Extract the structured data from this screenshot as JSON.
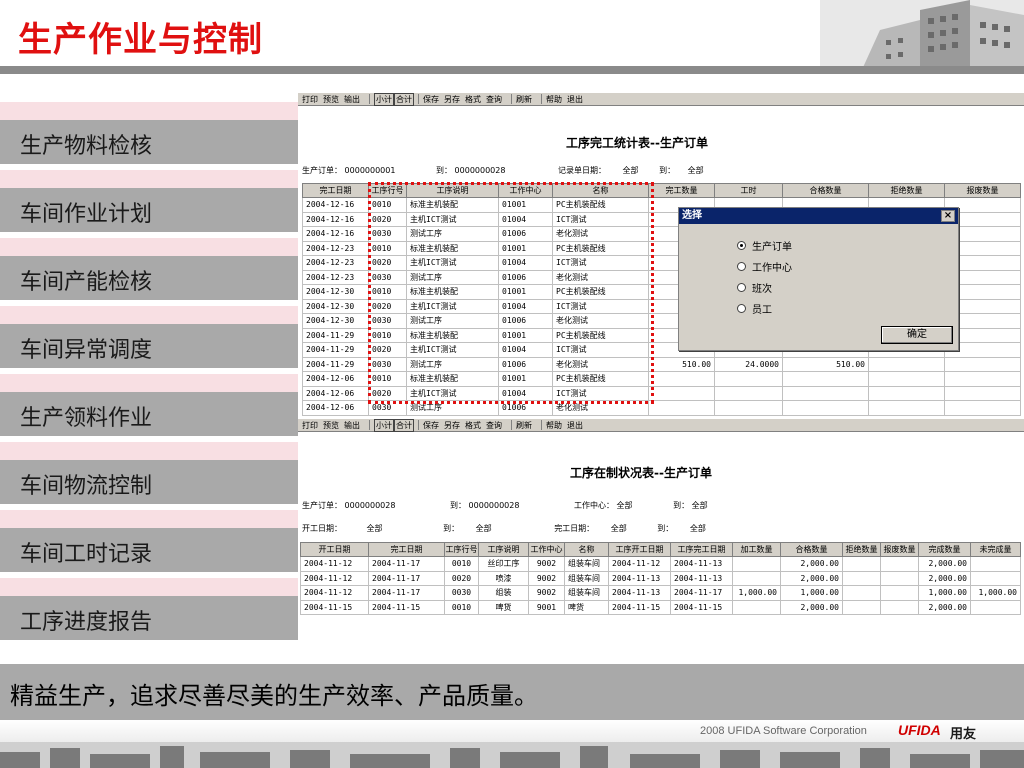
{
  "title": "生产作业与控制",
  "sidebar": {
    "items": [
      {
        "label": "生产物料检核"
      },
      {
        "label": "车间作业计划"
      },
      {
        "label": "车间产能检核"
      },
      {
        "label": "车间异常调度"
      },
      {
        "label": "生产领料作业"
      },
      {
        "label": "车间物流控制"
      },
      {
        "label": "车间工时记录"
      },
      {
        "label": "工序进度报告"
      }
    ]
  },
  "toolbar": {
    "buttons": [
      "打印",
      "预览",
      "输出",
      "小计",
      "合计",
      "保存",
      "另存",
      "格式",
      "查询",
      "刷新",
      "帮助",
      "退出"
    ]
  },
  "report1": {
    "title": "工序完工统计表--生产订单",
    "filter": {
      "order_label": "生产订单：",
      "order_from": "0000000001",
      "to_label": "到：",
      "order_to": "0000000028",
      "date_label": "记录单日期：",
      "date_from": "全部",
      "to_label2": "到：",
      "date_to": "全部"
    },
    "columns": [
      "完工日期",
      "工序行号",
      "工序说明",
      "工作中心",
      "名称",
      "完工数量",
      "工时",
      "合格数量",
      "拒绝数量",
      "报废数量"
    ],
    "rows": [
      [
        "2004-12-16",
        "0010",
        "标准主机装配",
        "01001",
        "PC主机装配线",
        "",
        "",
        "",
        "",
        ""
      ],
      [
        "2004-12-16",
        "0020",
        "主机ICT测试",
        "01004",
        "ICT测试",
        "",
        "",
        "",
        "",
        ""
      ],
      [
        "2004-12-16",
        "0030",
        "测试工序",
        "01006",
        "老化测试",
        "",
        "",
        "",
        "",
        ""
      ],
      [
        "2004-12-23",
        "0010",
        "标准主机装配",
        "01001",
        "PC主机装配线",
        "",
        "",
        "",
        "",
        ""
      ],
      [
        "2004-12-23",
        "0020",
        "主机ICT测试",
        "01004",
        "ICT测试",
        "",
        "",
        "",
        "",
        ""
      ],
      [
        "2004-12-23",
        "0030",
        "测试工序",
        "01006",
        "老化测试",
        "",
        "",
        "",
        "",
        ""
      ],
      [
        "2004-12-30",
        "0010",
        "标准主机装配",
        "01001",
        "PC主机装配线",
        "",
        "",
        "",
        "",
        ""
      ],
      [
        "2004-12-30",
        "0020",
        "主机ICT测试",
        "01004",
        "ICT测试",
        "",
        "",
        "",
        "",
        ""
      ],
      [
        "2004-12-30",
        "0030",
        "测试工序",
        "01006",
        "老化测试",
        "",
        "",
        "",
        "",
        ""
      ],
      [
        "2004-11-29",
        "0010",
        "标准主机装配",
        "01001",
        "PC主机装配线",
        "",
        "",
        "",
        "",
        ""
      ],
      [
        "2004-11-29",
        "0020",
        "主机ICT测试",
        "01004",
        "ICT测试",
        "",
        "",
        "",
        "",
        ""
      ],
      [
        "2004-11-29",
        "0030",
        "测试工序",
        "01006",
        "老化测试",
        "510.00",
        "24.0000",
        "510.00",
        "",
        ""
      ],
      [
        "2004-12-06",
        "0010",
        "标准主机装配",
        "01001",
        "PC主机装配线",
        "",
        "",
        "",
        "",
        ""
      ],
      [
        "2004-12-06",
        "0020",
        "主机ICT测试",
        "01004",
        "ICT测试",
        "",
        "",
        "",
        "",
        ""
      ],
      [
        "2004-12-06",
        "0030",
        "测试工序",
        "01006",
        "老化测试",
        "",
        "",
        "",
        "",
        ""
      ]
    ]
  },
  "dialog": {
    "title": "选择",
    "close": "×",
    "options": [
      {
        "label": "生产订单",
        "checked": true
      },
      {
        "label": "工作中心",
        "checked": false
      },
      {
        "label": "班次",
        "checked": false
      },
      {
        "label": "员工",
        "checked": false
      }
    ],
    "ok_label": "确定"
  },
  "report2": {
    "title": "工序在制状况表--生产订单",
    "filter1": {
      "order_label": "生产订单：",
      "order_from": "0000000028",
      "to_label": "到：",
      "order_to": "0000000028",
      "wc_label": "工作中心：",
      "wc_from": "全部",
      "to_label2": "到：",
      "wc_to": "全部"
    },
    "filter2": {
      "start_label": "开工日期：",
      "start_from": "全部",
      "to_label": "到：",
      "start_to": "全部",
      "finish_label": "完工日期：",
      "finish_from": "全部",
      "to_label2": "到：",
      "finish_to": "全部"
    },
    "columns": [
      "开工日期",
      "完工日期",
      "工序行号",
      "工序说明",
      "工作中心",
      "名称",
      "工序开工日期",
      "工序完工日期",
      "加工数量",
      "合格数量",
      "拒绝数量",
      "报废数量",
      "完成数量",
      "未完成量"
    ],
    "rows": [
      [
        "2004-11-12",
        "2004-11-17",
        "0010",
        "丝印工序",
        "9002",
        "组装车间",
        "2004-11-12",
        "2004-11-13",
        "",
        "2,000.00",
        "",
        "",
        "2,000.00",
        ""
      ],
      [
        "2004-11-12",
        "2004-11-17",
        "0020",
        "喷漆",
        "9002",
        "组装车间",
        "2004-11-13",
        "2004-11-13",
        "",
        "2,000.00",
        "",
        "",
        "2,000.00",
        ""
      ],
      [
        "2004-11-12",
        "2004-11-17",
        "0030",
        "组装",
        "9002",
        "组装车间",
        "2004-11-13",
        "2004-11-17",
        "1,000.00",
        "1,000.00",
        "",
        "",
        "1,000.00",
        "1,000.00"
      ],
      [
        "2004-11-15",
        "2004-11-15",
        "0010",
        "啤货",
        "9001",
        "啤货",
        "2004-11-15",
        "2004-11-15",
        "",
        "2,000.00",
        "",
        "",
        "2,000.00",
        ""
      ]
    ]
  },
  "slogan": "精益生产，追求尽善尽美的生产效率、产品质量。",
  "footer": {
    "copyright": "2008 UFIDA Software Corporation",
    "brand": "UFIDA",
    "brand_cn": "用友"
  },
  "colors": {
    "title_red": "#e01010",
    "sidebar_gray": "#a9a9a9",
    "sidebar_pink": "#f8dfe3",
    "dialog_title_blue": "#0a246a"
  }
}
